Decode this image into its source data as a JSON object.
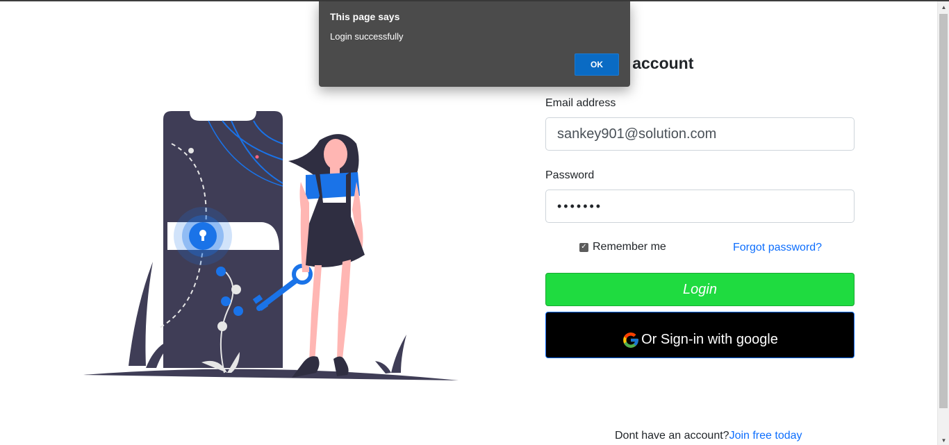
{
  "form": {
    "heading": "Login your account",
    "email_label": "Email address",
    "email_value": "sankey901@solution.com",
    "password_label": "Password",
    "password_value": "•••••••",
    "remember_label": "Remember me",
    "remember_checked": true,
    "forgot_label": "Forgot password?",
    "login_label": "Login",
    "google_label": "Or Sign-in with google",
    "signup_text": "Dont have an account?",
    "signup_link": "Join free today"
  },
  "dialog": {
    "title": "This page says",
    "message": "Login successfully",
    "ok_label": "OK"
  },
  "colors": {
    "login_button": "#1fdb40",
    "google_button": "#000000",
    "link": "#0d6efd",
    "dialog_bg": "#4b4b4b",
    "dialog_ok": "#0a6bc4",
    "illustration_dark": "#3f3d56",
    "illustration_blue": "#1a73e8",
    "skin": "#ffb6b3"
  },
  "icons": {
    "google": "google-g-icon",
    "checkbox": "check-icon",
    "lock": "keyhole-icon"
  }
}
